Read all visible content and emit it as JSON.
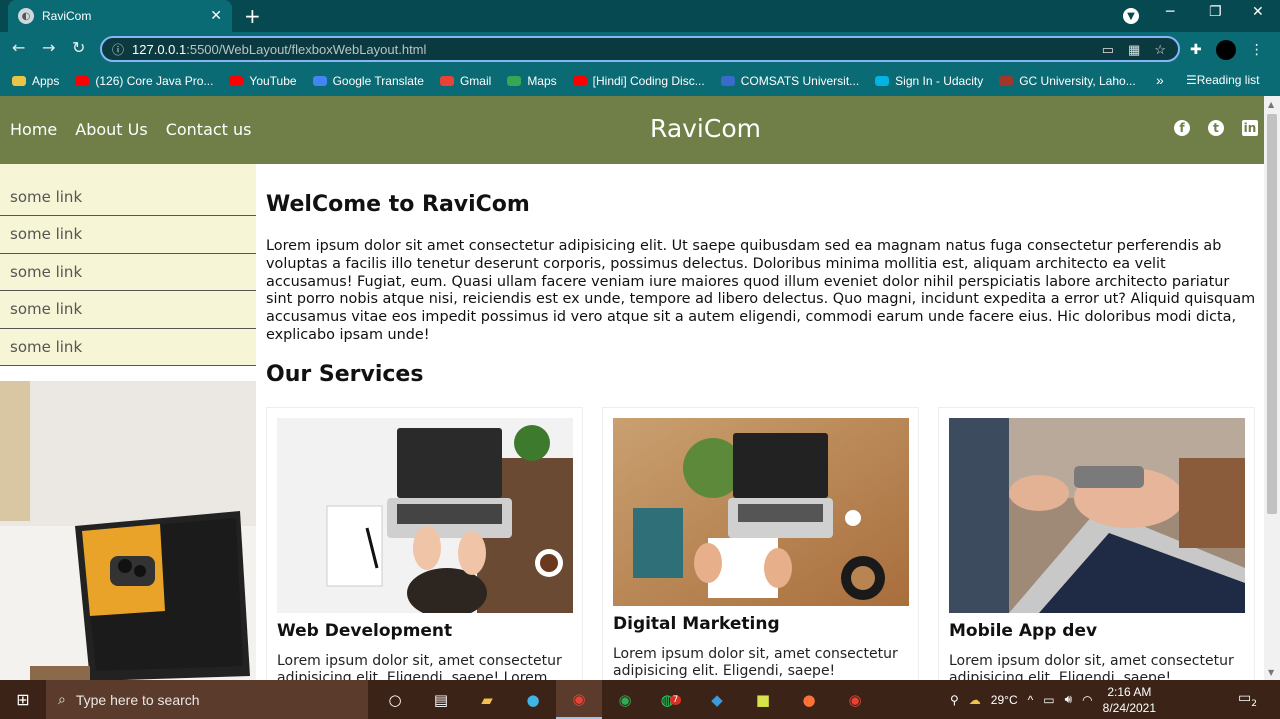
{
  "browser": {
    "tab_title": "RaviCom",
    "url_host": "127.0.0.1",
    "url_path": ":5500/WebLayout/flexboxWebLayout.html",
    "bookmarks": [
      {
        "label": "Apps",
        "color": "#e8c547"
      },
      {
        "label": "(126) Core Java Pro...",
        "color": "#ff0000"
      },
      {
        "label": "YouTube",
        "color": "#ff0000"
      },
      {
        "label": "Google Translate",
        "color": "#4285f4"
      },
      {
        "label": "Gmail",
        "color": "#ea4335"
      },
      {
        "label": "Maps",
        "color": "#34a853"
      },
      {
        "label": "[Hindi] Coding Disc...",
        "color": "#ff0000"
      },
      {
        "label": "COMSATS Universit...",
        "color": "#3a6bc9"
      },
      {
        "label": "Sign In - Udacity",
        "color": "#02b3e4"
      },
      {
        "label": "GC University, Laho...",
        "color": "#a3362b"
      }
    ],
    "reading_list": "Reading list",
    "more": "»"
  },
  "site": {
    "nav": [
      "Home",
      "About Us",
      "Contact us"
    ],
    "logo": "RaviCom",
    "side_links": [
      "some link",
      "some link",
      "some link",
      "some link",
      "some link"
    ],
    "welcome": "WelCome to RaviCom",
    "intro": "Lorem ipsum dolor sit amet consectetur adipisicing elit. Ut saepe quibusdam sed ea magnam natus fuga consectetur perferendis ab voluptas a facilis illo tenetur deserunt corporis, possimus delectus. Doloribus minima mollitia est, aliquam architecto ea velit accusamus! Fugiat, eum. Quasi ullam facere veniam iure maiores quod illum eveniet dolor nihil perspiciatis labore architecto pariatur sint porro nobis atque nisi, reiciendis est ex unde, tempore ad libero delectus. Quo magni, incidunt expedita a error ut? Aliquid quisquam accusamus vitae eos impedit possimus id vero atque sit a autem eligendi, commodi earum unde facere eius. Hic doloribus modi dicta, explicabo ipsam unde!",
    "services_heading": "Our Services",
    "cards": [
      {
        "title": "Web Development",
        "text": "Lorem ipsum dolor sit, amet consectetur adipisicing elit. Eligendi, saepe! Lorem"
      },
      {
        "title": "Digital Marketing",
        "text": "Lorem ipsum dolor sit, amet consectetur adipisicing elit. Eligendi, saepe!"
      },
      {
        "title": "Mobile App dev",
        "text": "Lorem ipsum dolor sit, amet consectetur adipisicing elit. Eligendi, saepe!"
      }
    ],
    "colors": {
      "header": "#6f7f47",
      "sidebar": "#f6f5d5"
    }
  },
  "taskbar": {
    "search_placeholder": "Type here to search",
    "weather": "29°C",
    "time": "2:16 AM",
    "date": "8/24/2021",
    "whatsapp_badge": "7",
    "notifications": "2"
  }
}
